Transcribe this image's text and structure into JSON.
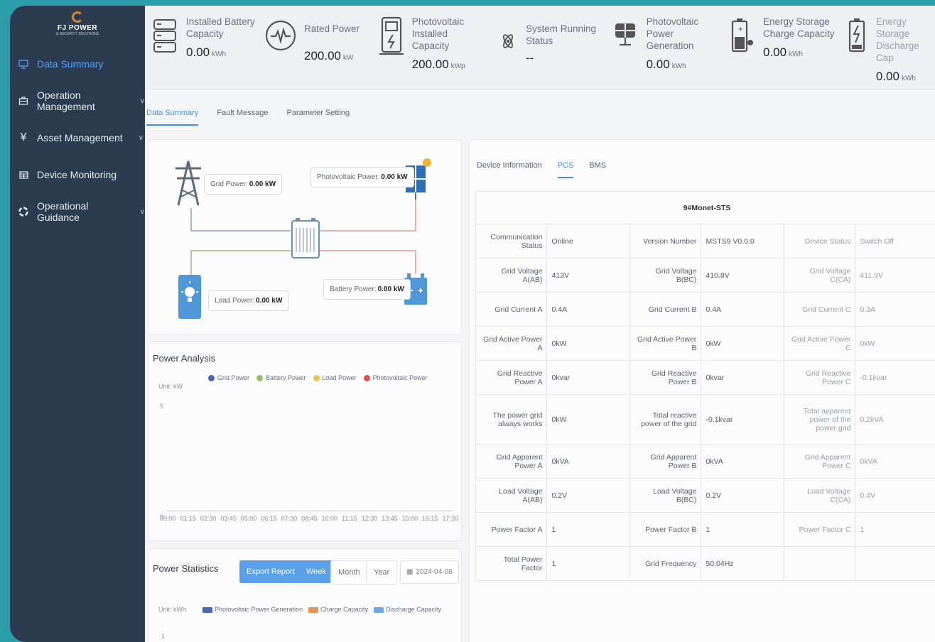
{
  "brand": {
    "name": "FJ POWER",
    "tagline": "& SECURITY SOLUTIONS"
  },
  "sidebar": {
    "items": [
      {
        "label": "Data Summary",
        "icon": "monitor-icon",
        "active": true
      },
      {
        "label": "Operation Management",
        "icon": "briefcase-icon",
        "chevron": "∨"
      },
      {
        "label": "Asset Management",
        "icon": "yen-icon",
        "chevron": "∨"
      },
      {
        "label": "Device Monitoring",
        "icon": "grid-icon"
      },
      {
        "label": "Operational Guidance",
        "icon": "compass-icon",
        "chevron": "∨"
      }
    ]
  },
  "stats": [
    {
      "label1": "Installed Battery",
      "label2": "Capacity",
      "value": "0.00",
      "unit": "kWh",
      "icon": "battery-stack-icon"
    },
    {
      "label1": "Rated Power",
      "label2": "",
      "value": "200.00",
      "unit": "kW",
      "icon": "pulse-icon"
    },
    {
      "label1": "Photovoltaic Installed",
      "label2": "Capacity",
      "value": "200.00",
      "unit": "kWp",
      "icon": "charging-station-icon"
    },
    {
      "label1": "System Running",
      "label2": "Status",
      "value": "--",
      "unit": "",
      "icon": "atom-icon"
    },
    {
      "label1": "Photovoltaic Power",
      "label2": "Generation",
      "value": "0.00",
      "unit": "kWh",
      "icon": "solar-panel-icon"
    },
    {
      "label1": "Energy Storage",
      "label2": "Charge Capacity",
      "value": "0.00",
      "unit": "kWh",
      "icon": "battery-charge-icon"
    },
    {
      "label1": "Energy Storage",
      "label2": "Discharge Cap",
      "value": "0.00",
      "unit": "kWh",
      "icon": "battery-discharge-icon"
    }
  ],
  "tabs": [
    "Data Summary",
    "Fault Message",
    "Parameter Setting"
  ],
  "flow": {
    "grid_label": "Grid Power:",
    "grid_value": "0.00 kW",
    "pv_label": "Photovoltaic Power:",
    "pv_value": "0.00 kW",
    "load_label": "Load Power:",
    "load_value": "0.00 kW",
    "battery_label": "Battery Power:",
    "battery_value": "0.00 kW"
  },
  "analysis": {
    "title": "Power Analysis",
    "unit": "Unit: kW",
    "y_top": "5",
    "y_zero": "0",
    "legend": [
      {
        "name": "Grid Power",
        "color": "#4b66b8"
      },
      {
        "name": "Battery Power",
        "color": "#8fc06a"
      },
      {
        "name": "Load Power",
        "color": "#f0c050"
      },
      {
        "name": "Photovoltaic Power",
        "color": "#d9534f"
      }
    ],
    "x_ticks": [
      "00:00",
      "01:15",
      "02:30",
      "03:45",
      "05:00",
      "06:15",
      "07:30",
      "08:45",
      "10:00",
      "11:15",
      "12:30",
      "13:45",
      "15:00",
      "16:15",
      "17:30"
    ]
  },
  "statistics": {
    "title": "Power Statistics",
    "export": "Export Report",
    "week": "Week",
    "month": "Month",
    "year": "Year",
    "date": "2024-04-08",
    "unit": "Unit: kWh",
    "y_first": "1",
    "legend": [
      {
        "name": "Photovoltaic Power Generation",
        "color": "#4b66b8"
      },
      {
        "name": "Charge Capacity",
        "color": "#e8935a"
      },
      {
        "name": "Discharge Capacity",
        "color": "#6aa8e8"
      }
    ]
  },
  "device": {
    "tabs": [
      "Device Information",
      "PCS",
      "BMS"
    ],
    "title": "9#Monet-STS",
    "rows": [
      [
        "Communication Status",
        "Online",
        "Version Number",
        "MSTS9 V0.0.0",
        "Device Status",
        "Switch Off"
      ],
      [
        "Grid Voltage A(AB)",
        "413V",
        "Grid Voltage B(BC)",
        "410.8V",
        "Grid Voltage C(CA)",
        "411.9V"
      ],
      [
        "Grid Current A",
        "0.4A",
        "Grid Current B",
        "0.4A",
        "Grid Current C",
        "0.3A"
      ],
      [
        "Grid Active Power A",
        "0kW",
        "Grid Active Power B",
        "0kW",
        "Grid Active Power C",
        "0kW"
      ],
      [
        "Grid Reactive Power A",
        "0kvar",
        "Grid Reactive Power B",
        "0kvar",
        "Grid Reactive Power C",
        "-0.1kvar"
      ],
      [
        "The power grid always works",
        "0kW",
        "Total reactive power of the grid",
        "-0.1kvar",
        "Total apparent power of the power grid",
        "0.2kVA"
      ],
      [
        "Grid Apparent Power A",
        "0kVA",
        "Grid Apparent Power B",
        "0kVA",
        "Grid Apparent Power C",
        "0kVA"
      ],
      [
        "Load Voltage A(AB)",
        "0.2V",
        "Load Voltage B(BC)",
        "0.2V",
        "Load Voltage C(CA)",
        "0.4V"
      ],
      [
        "Power Factor A",
        "1",
        "Power Factor B",
        "1",
        "Power Factor C",
        "1"
      ],
      [
        "Total Power Factor",
        "1",
        "Grid Frequency",
        "50.04Hz",
        "",
        ""
      ]
    ]
  },
  "colors": {
    "accent": "#4a90e2",
    "sidebar": "#2c3c50",
    "frame": "#2a9da8"
  }
}
